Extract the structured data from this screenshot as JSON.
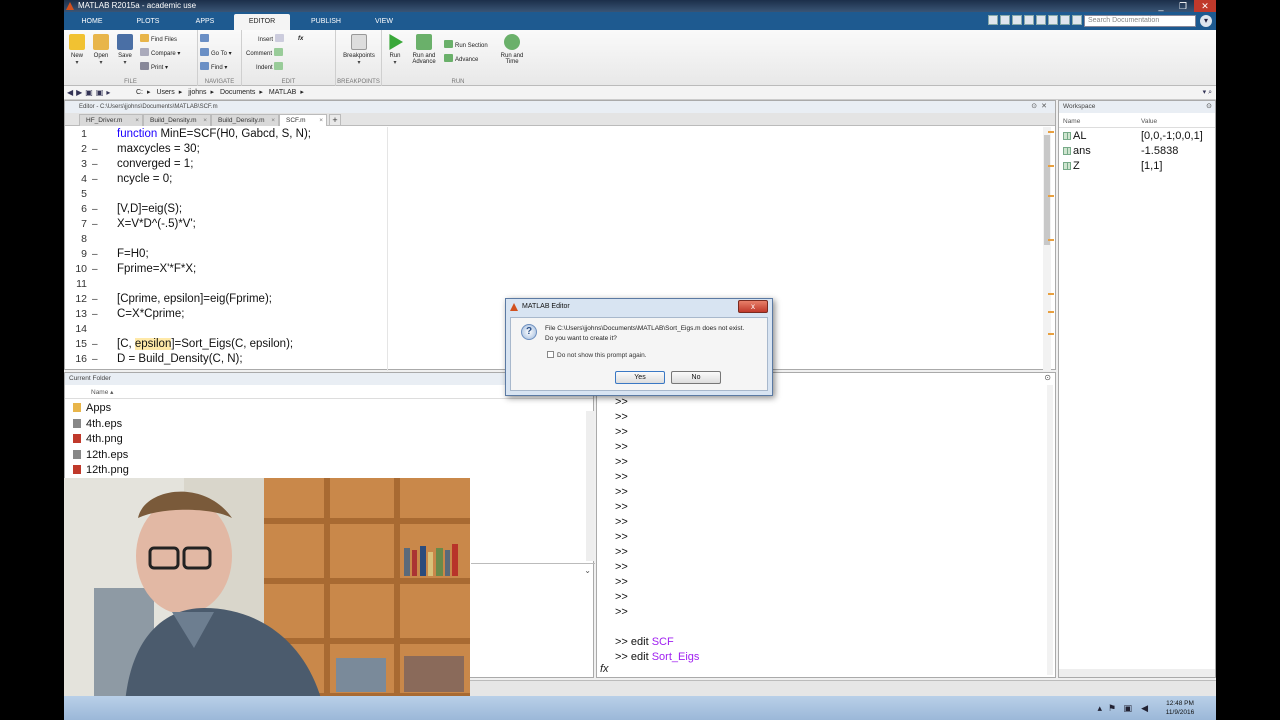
{
  "window": {
    "title": "MATLAB R2015a - academic use",
    "controls": [
      "_",
      "❐",
      "✕"
    ]
  },
  "ribbon_tabs": [
    {
      "label": "HOME",
      "active": false
    },
    {
      "label": "PLOTS",
      "active": false
    },
    {
      "label": "APPS",
      "active": false
    },
    {
      "label": "EDITOR",
      "active": true
    },
    {
      "label": "PUBLISH",
      "active": false
    },
    {
      "label": "VIEW",
      "active": false
    }
  ],
  "search": {
    "placeholder": "Search Documentation"
  },
  "ribbon": {
    "file": {
      "caption": "FILE",
      "new": "New",
      "open": "Open",
      "save": "Save",
      "find_files": "Find Files",
      "compare": "Compare",
      "print": "Print"
    },
    "navigate": {
      "caption": "NAVIGATE",
      "goto": "Go To",
      "find": "Find"
    },
    "edit": {
      "caption": "EDIT",
      "insert": "Insert",
      "comment": "Comment",
      "indent": "Indent",
      "fx": "fx"
    },
    "breakpoints": {
      "caption": "BREAKPOINTS",
      "label": "Breakpoints"
    },
    "run": {
      "caption": "RUN",
      "run": "Run",
      "run_advance_1": "Run and",
      "run_advance_2": "Advance",
      "run_section": "Run Section",
      "advance": "Advance",
      "run_time_1": "Run and",
      "run_time_2": "Time"
    }
  },
  "address": {
    "segments": [
      "C:",
      "Users",
      "jjohns",
      "Documents",
      "MATLAB"
    ]
  },
  "editor": {
    "header": "Editor - C:\\Users\\jjohns\\Documents\\MATLAB\\SCF.m",
    "tabs": [
      {
        "label": "HF_Driver.m",
        "active": false
      },
      {
        "label": "Build_Density.m",
        "active": false
      },
      {
        "label": "Build_Density.m",
        "active": false
      },
      {
        "label": "SCF.m",
        "active": true
      }
    ],
    "lines": [
      {
        "n": "1",
        "dash": "",
        "pre": "",
        "kw": "function",
        "post": " MinE=SCF(H0, Gabcd, S, N);",
        "hl": ""
      },
      {
        "n": "2",
        "dash": "–",
        "pre": "maxcycles = 30;",
        "kw": "",
        "post": "",
        "hl": ""
      },
      {
        "n": "3",
        "dash": "–",
        "pre": "converged = 1;",
        "kw": "",
        "post": "",
        "hl": ""
      },
      {
        "n": "4",
        "dash": "–",
        "pre": "ncycle = 0;",
        "kw": "",
        "post": "",
        "hl": ""
      },
      {
        "n": "5",
        "dash": "",
        "pre": "",
        "kw": "",
        "post": "",
        "hl": ""
      },
      {
        "n": "6",
        "dash": "–",
        "pre": "[V,D]=eig(S);",
        "kw": "",
        "post": "",
        "hl": ""
      },
      {
        "n": "7",
        "dash": "–",
        "pre": "X=V*D^(-.5)*V';",
        "kw": "",
        "post": "",
        "hl": ""
      },
      {
        "n": "8",
        "dash": "",
        "pre": "",
        "kw": "",
        "post": "",
        "hl": ""
      },
      {
        "n": "9",
        "dash": "–",
        "pre": "F=H0;",
        "kw": "",
        "post": "",
        "hl": ""
      },
      {
        "n": "10",
        "dash": "–",
        "pre": "Fprime=X'*F*X;",
        "kw": "",
        "post": "",
        "hl": ""
      },
      {
        "n": "11",
        "dash": "",
        "pre": "",
        "kw": "",
        "post": "",
        "hl": ""
      },
      {
        "n": "12",
        "dash": "–",
        "pre": "[Cprime, epsilon]=eig(Fprime);",
        "kw": "",
        "post": "",
        "hl": ""
      },
      {
        "n": "13",
        "dash": "–",
        "pre": "C=X*Cprime;",
        "kw": "",
        "post": "",
        "hl": ""
      },
      {
        "n": "14",
        "dash": "",
        "pre": "",
        "kw": "",
        "post": "",
        "hl": ""
      },
      {
        "n": "15",
        "dash": "–",
        "pre": "[C, ",
        "kw": "",
        "post": "]=Sort_Eigs(C, epsilon);",
        "hl": "epsilon"
      },
      {
        "n": "16",
        "dash": "–",
        "pre": "D = Build_Density(C, N);",
        "kw": "",
        "post": "",
        "hl": ""
      }
    ]
  },
  "current_folder": {
    "title": "Current Folder",
    "column": "Name",
    "items": [
      {
        "name": "Apps",
        "type": "folder"
      },
      {
        "name": "4th.eps",
        "type": "eps"
      },
      {
        "name": "4th.png",
        "type": "png"
      },
      {
        "name": "12th.eps",
        "type": "eps"
      },
      {
        "name": "12th.png",
        "type": "png"
      }
    ]
  },
  "command_window": {
    "prompts": [
      ">>",
      ">>",
      ">>",
      ">>",
      ">>",
      ">>",
      ">>",
      ">>",
      ">>",
      ">>",
      ">>",
      ">>",
      ">>",
      ">>",
      ">>"
    ],
    "history": [
      {
        "prompt": ">> ",
        "cmd": "edit ",
        "arg": "SCF"
      },
      {
        "prompt": ">> ",
        "cmd": "edit ",
        "arg": "Sort_Eigs"
      }
    ],
    "fx": "fx"
  },
  "workspace": {
    "title": "Workspace",
    "col_name": "Name",
    "col_value": "Value",
    "vars": [
      {
        "name": "AL",
        "value": "[0,0,-1;0,0,1]"
      },
      {
        "name": "ans",
        "value": "-1.5838"
      },
      {
        "name": "Z",
        "value": "[1,1]"
      }
    ]
  },
  "dialog": {
    "title": "MATLAB Editor",
    "message_1": "File C:\\Users\\jjohns\\Documents\\MATLAB\\Sort_Eigs.m does not exist.",
    "message_2": "Do you want to create it?",
    "checkbox": "Do not show this prompt again.",
    "yes": "Yes",
    "no": "No",
    "close": "x"
  },
  "taskbar": {
    "time": "12:48 PM",
    "date": "11/9/2016"
  },
  "colors": {
    "keyword": "#1b00ff",
    "string_arg": "#a020f0",
    "ribbon_tab": "#1e5a90"
  }
}
